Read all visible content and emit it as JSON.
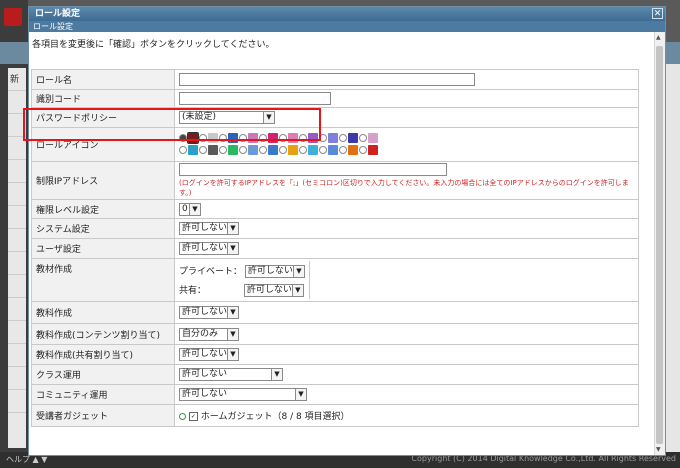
{
  "window": {
    "title": "ロール設定",
    "subtitle": "ロール設定",
    "close_glyph": "✕"
  },
  "instruction": "各項目を変更後に「確認」ボタンをクリックしてください。",
  "fields": {
    "role_name": {
      "label": "ロール名",
      "value": ""
    },
    "identifier": {
      "label": "識別コード",
      "value": ""
    },
    "password_policy": {
      "label": "パスワードポリシー",
      "value": "(未設定)"
    },
    "role_icon": {
      "label": "ロールアイコン"
    },
    "ip_address": {
      "label": "制限IPアドレス",
      "value": "",
      "note": "(ログインを許可するIPアドレスを「;」(セミコロン)区切りで入力してください。未入力の場合には全てのIPアドレスからのログインを許可します。)"
    },
    "authority_level": {
      "label": "権限レベル設定",
      "value": "0"
    },
    "system_settings": {
      "label": "システム設定",
      "value": "許可しない"
    },
    "user_settings": {
      "label": "ユーザ設定",
      "value": "許可しない"
    },
    "material_creation": {
      "label": "教材作成",
      "private_label": "プライベート：",
      "private_value": "許可しない",
      "shared_label": "共有：",
      "shared_value": "許可しない"
    },
    "course_creation": {
      "label": "教科作成",
      "value": "許可しない"
    },
    "course_content": {
      "label": "教科作成(コンテンツ割り当て)",
      "value": "自分のみ"
    },
    "course_shared": {
      "label": "教科作成(共有割り当て)",
      "value": "許可しない"
    },
    "class_operation": {
      "label": "クラス運用",
      "value": "許可しない"
    },
    "community_operation": {
      "label": "コミュニティ運用",
      "value": "許可しない"
    },
    "student_gadget": {
      "label": "受講者ガジェット",
      "value": "ホームガジェット（8 / 8 項目選択）"
    }
  },
  "icon_colors": {
    "row1": [
      "#7a1a1a",
      "#c8c8c8",
      "#2a63b8",
      "#c87ab8",
      "#d2246e",
      "#e07ab2",
      "#9a58c8",
      "#8080d8",
      "#3a3aa8",
      "#d8a0c8"
    ],
    "row2": [
      "#2aa0c8",
      "#5a5a5a",
      "#2ab860",
      "#6a9ad8",
      "#3a7ac8",
      "#e8a010",
      "#40b0d8",
      "#5a8ad8",
      "#e07010",
      "#d02020"
    ]
  },
  "background": {
    "copyright": "Copyright (C) 2014 Digital Knowledge Co.,Ltd. All Rights Reserved",
    "help_label": "ヘルプ ▲ ▼",
    "left_label": "新"
  },
  "colors": {
    "accent": "#3e6b91",
    "highlight": "#e8141c",
    "note_red": "#d02020"
  }
}
